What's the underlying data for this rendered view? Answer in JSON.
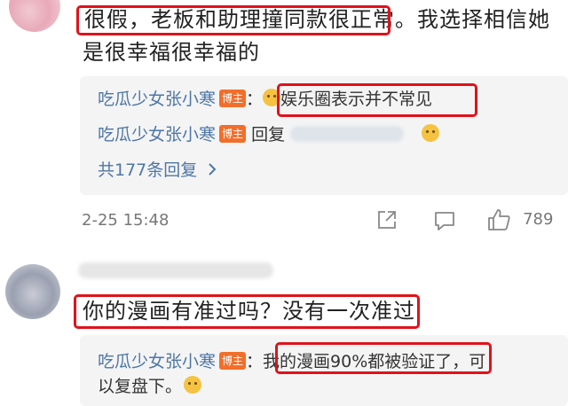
{
  "comment1": {
    "text_highlighted": "很假，老板和助理撞同款很正常",
    "text_rest": "。我选择相信她",
    "text_line2": "是很幸福很幸福的",
    "replies": [
      {
        "author": "吃瓜少女张小寒",
        "badge": "博主",
        "separator": "：",
        "body": "娱乐圈表示并不常见"
      },
      {
        "author": "吃瓜少女张小寒",
        "badge": "博主",
        "body_prefix": "回复"
      }
    ],
    "more_replies": "共177条回复",
    "date": "2-25 15:48",
    "like_count": "789"
  },
  "comment2": {
    "text": "你的漫画有准过吗？没有一次准过",
    "reply": {
      "author": "吃瓜少女张小寒",
      "badge": "博主",
      "separator": "：",
      "body_highlighted": "我的漫画90%都被验证了",
      "body_rest": "，可",
      "body_line2": "以复盘下。"
    }
  },
  "colors": {
    "highlight": "#e0121b",
    "author": "#4e76a8",
    "badge": "#f26e2a"
  },
  "icons": [
    "share-icon",
    "comment-icon",
    "like-icon",
    "chevron-right-icon",
    "emoji-icon"
  ]
}
